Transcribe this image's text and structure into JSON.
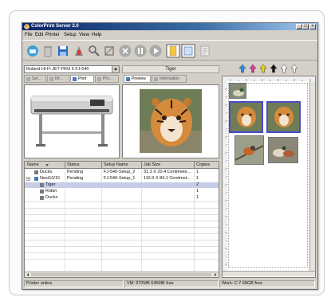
{
  "window": {
    "title": "ColorPrint Server 2.0",
    "controls": [
      "_",
      "□",
      "×"
    ]
  },
  "menu": [
    "File",
    "Edit",
    "Printer",
    "Setup",
    "View",
    "Help"
  ],
  "toolbar": {
    "buttons": [
      "new-icon",
      "trash-icon",
      "save-icon",
      "settings-icon",
      "zoom-icon",
      "crop-icon",
      "stop-icon",
      "pause-icon",
      "play-icon",
      "page-portrait-icon",
      "page-layout-icon",
      "cut-marks-icon"
    ]
  },
  "printer_selector": {
    "value": "Roland Hi-Fi JET PRO II FJ-540"
  },
  "printer_tabs": [
    "Set...",
    "Inf...",
    "Print",
    "Pro..."
  ],
  "job_name": "Tiger",
  "job_tabs": [
    "Preview",
    "Information"
  ],
  "table": {
    "columns": [
      "Name",
      "Status",
      "Setup Name",
      "Job Size",
      "Copies"
    ],
    "rows": [
      {
        "name": "Ducks",
        "status": "Pending",
        "setup": "FJ-540-Setup_2",
        "size": "31.3 X 20.4 Centimete...",
        "copies": "1"
      },
      {
        "name": "Nest10/15",
        "status": "Pending",
        "setup": "FJ-540-Setup_1",
        "size": "116.9 X 84.1 Centimet...",
        "copies": "1"
      },
      {
        "name": "Tiger",
        "status": "",
        "setup": "",
        "size": "",
        "copies": "2"
      },
      {
        "name": "Robin",
        "status": "",
        "setup": "",
        "size": "",
        "copies": "1"
      },
      {
        "name": "Ducks",
        "status": "",
        "setup": "",
        "size": "",
        "copies": "1"
      }
    ]
  },
  "status": {
    "printer": "Printer online",
    "vm": "VM: 970MB 645MB free",
    "work": "Work: C:7.68GB free"
  },
  "layout_arrows": {
    "colors": [
      "#2f8ee6",
      "#e23b8f",
      "#f0d800",
      "#111111",
      "#ffffff",
      "#ffffff"
    ]
  },
  "colors": {
    "window_bg": "#d4d0c8",
    "title_bar": "#0a246a",
    "selection": "#c6cde8",
    "thumb_selection": "#4a4acb"
  }
}
